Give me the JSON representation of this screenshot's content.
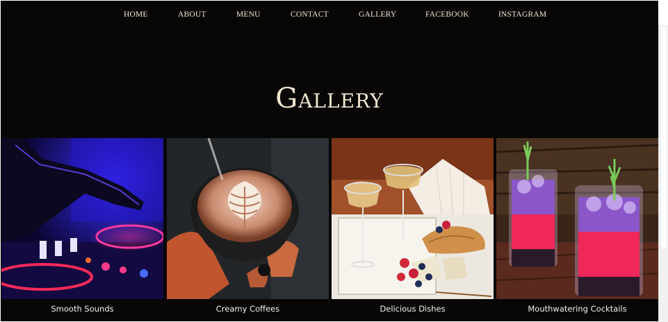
{
  "nav": {
    "items": [
      "HOME",
      "ABOUT",
      "MENU",
      "CONTACT",
      "GALLERY",
      "FACEBOOK",
      "INSTAGRAM"
    ]
  },
  "gallery": {
    "title": "Gallery",
    "items": [
      {
        "caption": "Smooth Sounds",
        "image": "dj-mixer-photo"
      },
      {
        "caption": "Creamy Coffees",
        "image": "latte-art-photo"
      },
      {
        "caption": "Delicious Dishes",
        "image": "champagne-cheese-platter-photo"
      },
      {
        "caption": "Mouthwatering Cocktails",
        "image": "pink-cocktails-photo"
      }
    ]
  },
  "colors": {
    "background": "#080706",
    "nav_text": "#f2e6cf",
    "title_text": "#f2e6cf",
    "caption_text": "#f4f1ec"
  }
}
